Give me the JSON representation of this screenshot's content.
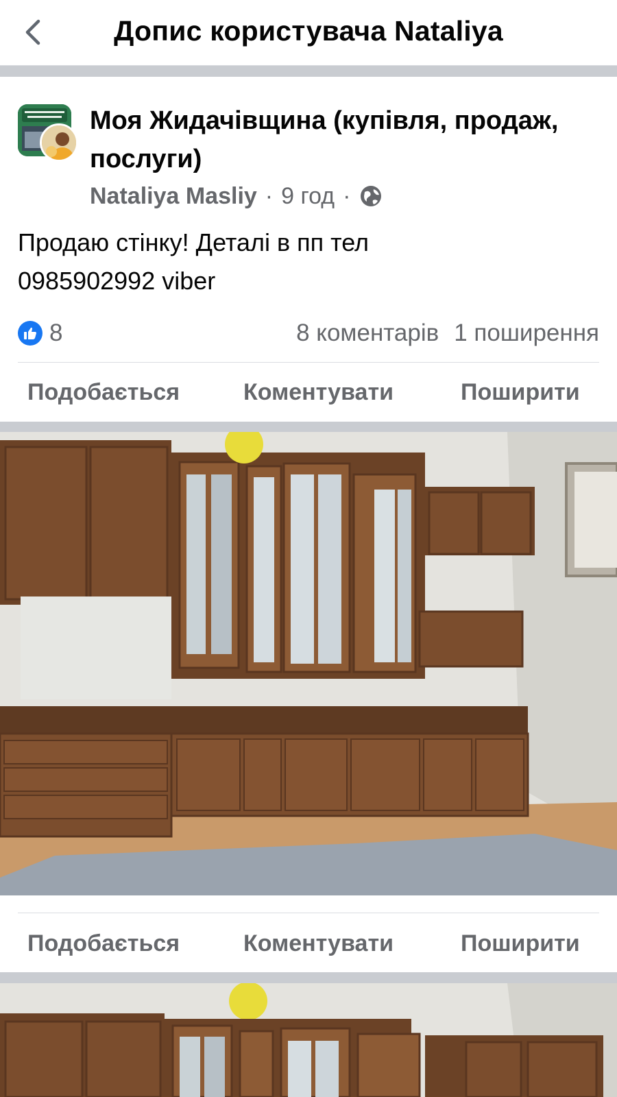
{
  "header": {
    "title": "Допис користувача Nataliya"
  },
  "post": {
    "group_name": "Моя Жидачівщина (купівля, продаж, послуги)",
    "author": "Nataliya Masliy",
    "dot": "·",
    "time": "9 год",
    "text": "Продаю стінку! Деталі в пп тел\n0985902992  viber",
    "reactions_count": "8",
    "comments": "8 коментарів",
    "shares": "1 поширення"
  },
  "actions": {
    "like": "Подобається",
    "comment": "Коментувати",
    "share": "Поширити"
  },
  "icons": {
    "back": "chevron-left-icon",
    "privacy": "globe-icon",
    "like": "thumbs-up-icon"
  },
  "colors": {
    "brand": "#1877f2",
    "secondary_text": "#65676b",
    "separator": "#c9ccd1"
  }
}
